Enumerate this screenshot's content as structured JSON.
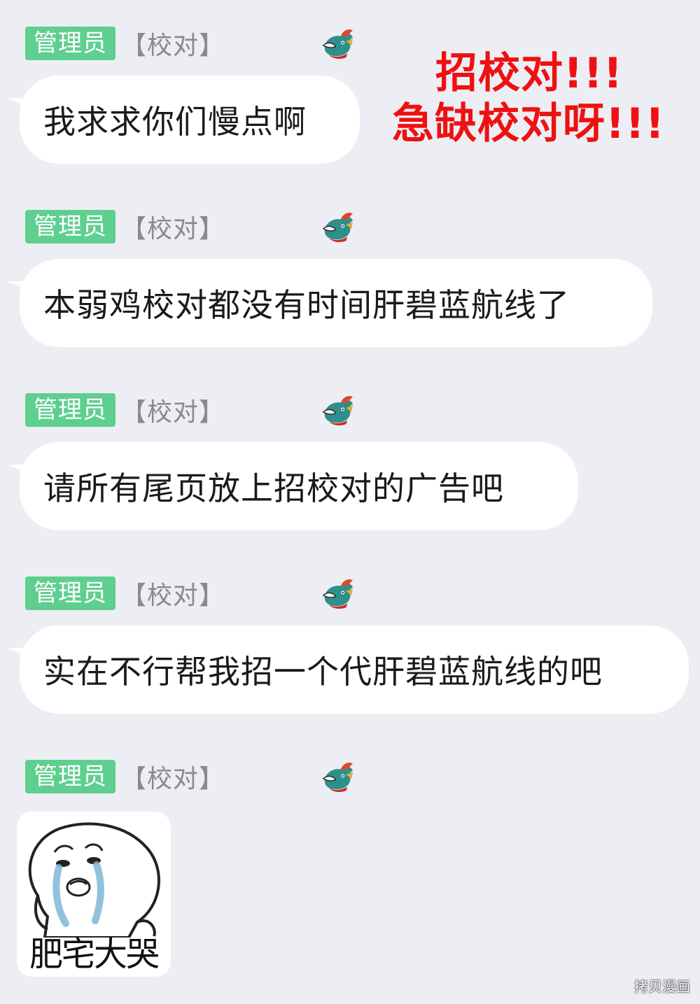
{
  "banner": {
    "line1": "招校对!!!",
    "line2": "急缺校对呀!!!"
  },
  "messages": [
    {
      "role": "管理员",
      "title": "【校对】",
      "text": "我求求你们慢点啊"
    },
    {
      "role": "管理员",
      "title": "【校对】",
      "text": "本弱鸡校对都没有时间肝碧蓝航线了"
    },
    {
      "role": "管理员",
      "title": "【校对】",
      "text": "请所有尾页放上招校对的广告吧"
    },
    {
      "role": "管理员",
      "title": "【校对】",
      "text": "实在不行帮我招一个代肝碧蓝航线的吧"
    },
    {
      "role": "管理员",
      "title": "【校对】",
      "sticker_caption": "肥宅大哭"
    }
  ],
  "watermark": "拷贝漫画",
  "colors": {
    "role_badge": "#5fcf8f",
    "banner": "#ee1111",
    "background": "#eceef4"
  },
  "icons": {
    "avatar": "dragon-avatar-icon",
    "sticker": "crying-blob-sticker"
  }
}
